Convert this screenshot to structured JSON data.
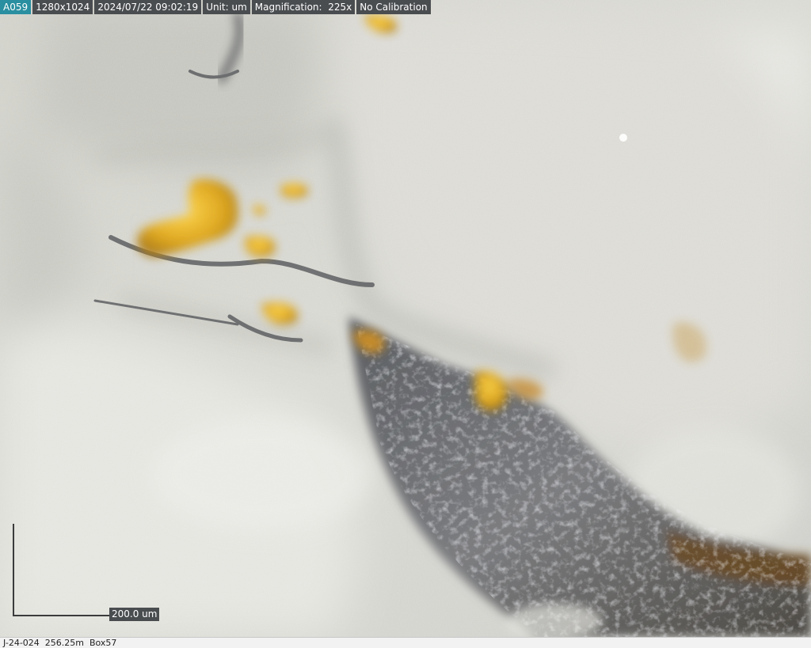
{
  "overlay": {
    "image_id": "A059",
    "resolution": "1280x1024",
    "datetime": "2024/07/22 09:02:19",
    "unit": "Unit: um",
    "magnification": "Magnification:  225x",
    "calibration": "No Calibration"
  },
  "scale_bar": {
    "label": "200.0 um"
  },
  "footer": {
    "caption": "J-24-024  256.25m  Box57"
  },
  "colors": {
    "quartz": "#d8d7d0",
    "gold": "#e0a81c",
    "sulfide": "#6e6e72",
    "overlay_bg": "#4a4d50",
    "id_tag_bg": "#2a8fa0"
  }
}
